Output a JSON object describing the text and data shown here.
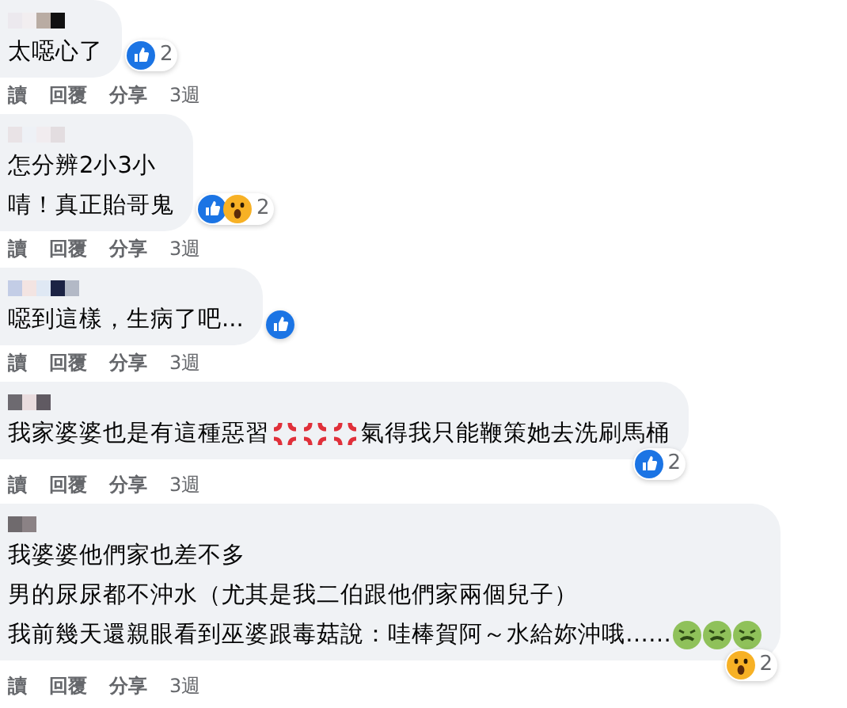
{
  "comments": [
    {
      "lines": [
        [
          {
            "kind": "text",
            "text": "太噁心了"
          }
        ]
      ],
      "reactions": {
        "items": [
          {
            "kind": "like"
          }
        ],
        "count": "2"
      },
      "actions": [
        "讀",
        "回覆",
        "分享"
      ],
      "time": "3週"
    },
    {
      "lines": [
        [
          {
            "kind": "text",
            "text": "怎分辨2小3小"
          }
        ],
        [
          {
            "kind": "text",
            "text": "啨！真正貽哥鬼"
          }
        ]
      ],
      "reactions": {
        "items": [
          {
            "kind": "like"
          },
          {
            "kind": "wow"
          }
        ],
        "count": "2"
      },
      "actions": [
        "讀",
        "回覆",
        "分享"
      ],
      "time": "3週"
    },
    {
      "lines": [
        [
          {
            "kind": "text",
            "text": "噁到這樣，生病了吧..."
          }
        ]
      ],
      "reactions": {
        "items": [
          {
            "kind": "like"
          }
        ]
      },
      "actions": [
        "讀",
        "回覆",
        "分享"
      ],
      "time": "3週"
    },
    {
      "lines": [
        [
          {
            "kind": "text",
            "text": "我家婆婆也是有這種惡習"
          },
          {
            "kind": "anger"
          },
          {
            "kind": "anger"
          },
          {
            "kind": "anger"
          },
          {
            "kind": "text",
            "text": "氣得我只能鞭策她去洗刷馬桶"
          }
        ]
      ],
      "reactions": {
        "items": [
          {
            "kind": "like"
          }
        ],
        "count": "2"
      },
      "actions": [
        "讀",
        "回覆",
        "分享"
      ],
      "time": "3週"
    },
    {
      "lines": [
        [
          {
            "kind": "text",
            "text": "我婆婆他們家也差不多"
          }
        ],
        [
          {
            "kind": "text",
            "text": "男的尿尿都不沖水（尤其是我二伯跟他們家兩個兒子）"
          }
        ],
        [
          {
            "kind": "text",
            "text": "我前幾天還親眼看到巫婆跟毒菇說：哇棒賀阿～水給妳沖哦……"
          },
          {
            "kind": "nauseated"
          },
          {
            "kind": "nauseated"
          },
          {
            "kind": "nauseated"
          }
        ]
      ],
      "reactions": {
        "items": [
          {
            "kind": "wow"
          }
        ],
        "count": "2"
      },
      "actions": [
        "讀",
        "回覆",
        "分享"
      ],
      "time": "3週"
    }
  ]
}
